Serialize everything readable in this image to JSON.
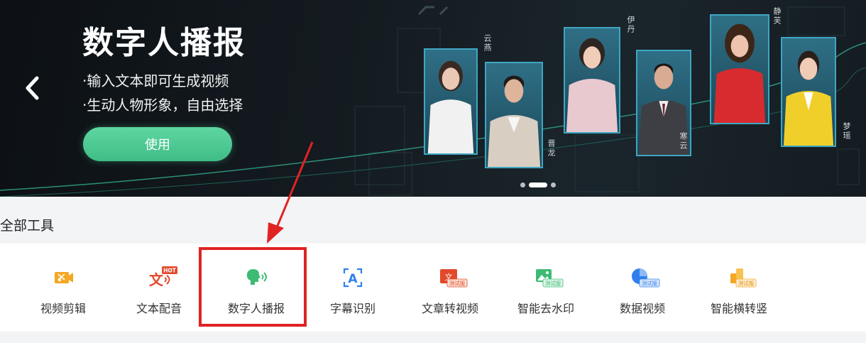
{
  "banner": {
    "title": "数字人播报",
    "line1": "·输入文本即可生成视频",
    "line2": "·生动人物形象，自由选择",
    "use_button": "使用",
    "avatars": [
      {
        "name": "云燕"
      },
      {
        "name": "晋龙"
      },
      {
        "name": "伊丹"
      },
      {
        "name": "寒云"
      },
      {
        "name": "静芙"
      },
      {
        "name": "梦瑶"
      }
    ],
    "carousel_index": 2,
    "carousel_count": 3
  },
  "section": {
    "title": "全部工具"
  },
  "tools": [
    {
      "label": "视频剪辑",
      "icon": "video-camera-scissors-icon",
      "badge": ""
    },
    {
      "label": "文本配音",
      "icon": "text-dubbing-icon",
      "badge": "HOT"
    },
    {
      "label": "数字人播报",
      "icon": "digital-human-speaking-icon",
      "badge": ""
    },
    {
      "label": "字幕识别",
      "icon": "subtitle-recognition-icon",
      "badge": ""
    },
    {
      "label": "文章转视频",
      "icon": "article-to-video-icon",
      "badge": "测试版"
    },
    {
      "label": "智能去水印",
      "icon": "watermark-removal-icon",
      "badge": "测试版"
    },
    {
      "label": "数据视频",
      "icon": "data-video-icon",
      "badge": "测试版"
    },
    {
      "label": "智能横转竖",
      "icon": "landscape-to-portrait-icon",
      "badge": "测试版"
    }
  ],
  "colors": {
    "accent_green": "#3fbd86",
    "highlight_red": "#e02323",
    "icon_orange": "#f5a623",
    "icon_green": "#3dbb74",
    "icon_blue": "#2f80ed"
  }
}
